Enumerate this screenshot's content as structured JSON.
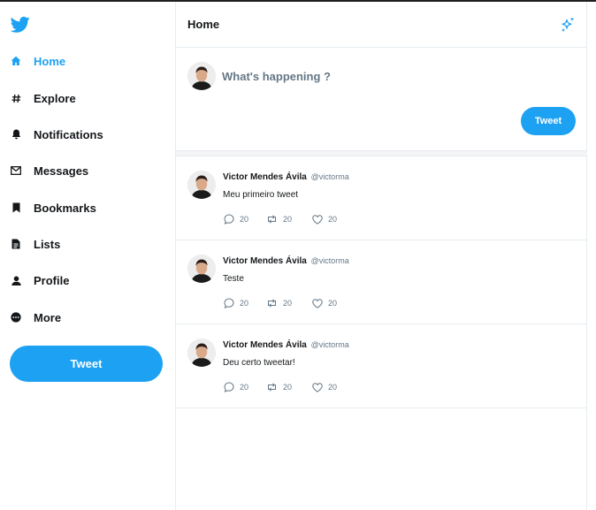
{
  "colors": {
    "accent": "#1da1f2",
    "text": "#14171a",
    "muted": "#657786",
    "border": "#e6ecf0"
  },
  "sidebar": {
    "logo": "twitter-bird-icon",
    "items": [
      {
        "label": "Home",
        "icon": "home-icon",
        "active": true
      },
      {
        "label": "Explore",
        "icon": "hashtag-icon"
      },
      {
        "label": "Notifications",
        "icon": "bell-icon"
      },
      {
        "label": "Messages",
        "icon": "envelope-icon"
      },
      {
        "label": "Bookmarks",
        "icon": "bookmark-icon"
      },
      {
        "label": "Lists",
        "icon": "list-document-icon"
      },
      {
        "label": "Profile",
        "icon": "person-icon"
      },
      {
        "label": "More",
        "icon": "more-dots-icon"
      }
    ],
    "tweet_button": "Tweet"
  },
  "header": {
    "title": "Home",
    "action_icon": "sparkle-icon"
  },
  "composer": {
    "placeholder": "What's happening ?",
    "tweet_button": "Tweet"
  },
  "feed": {
    "tweets": [
      {
        "name": "Victor Mendes Ávila",
        "handle": "@victorma",
        "text": "Meu primeiro tweet",
        "replies": "20",
        "retweets": "20",
        "likes": "20"
      },
      {
        "name": "Victor Mendes Ávila",
        "handle": "@victorma",
        "text": "Teste",
        "replies": "20",
        "retweets": "20",
        "likes": "20"
      },
      {
        "name": "Victor Mendes Ávila",
        "handle": "@victorma",
        "text": "Deu certo tweetar!",
        "replies": "20",
        "retweets": "20",
        "likes": "20"
      }
    ]
  }
}
